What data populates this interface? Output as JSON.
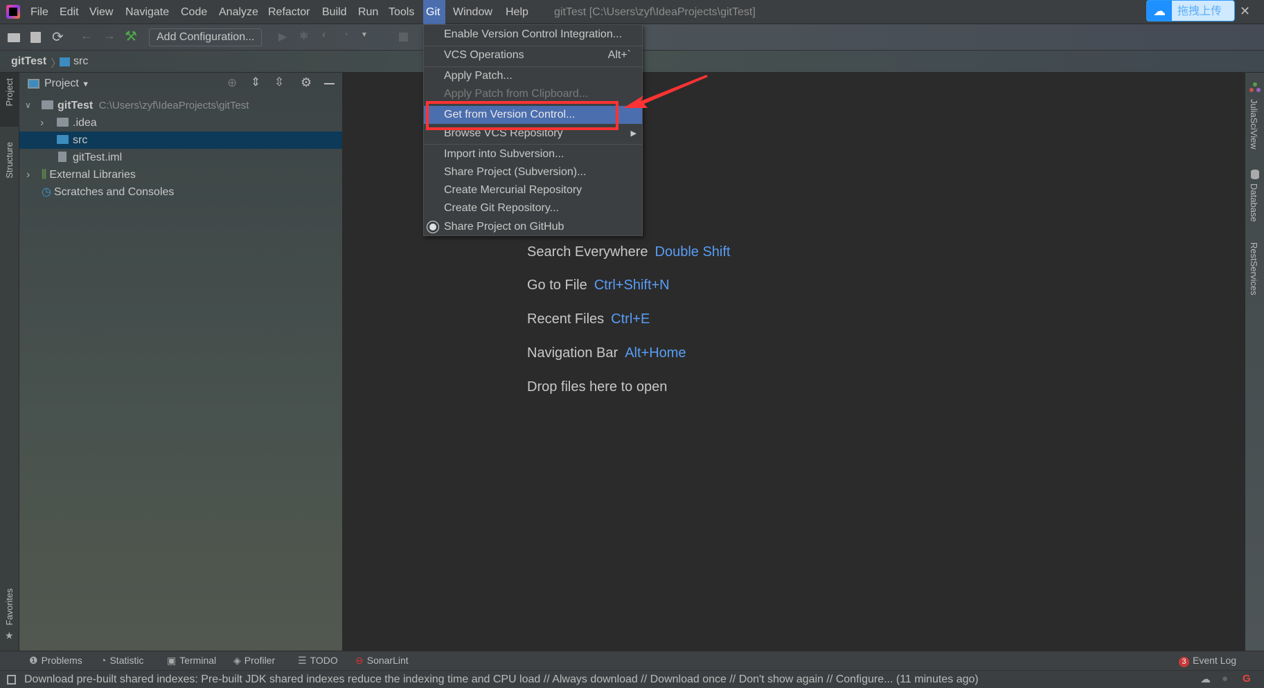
{
  "menubar": {
    "items": [
      "File",
      "Edit",
      "View",
      "Navigate",
      "Code",
      "Analyze",
      "Refactor",
      "Build",
      "Run",
      "Tools",
      "Git",
      "Window",
      "Help"
    ],
    "active": "Git",
    "title": "gitTest [C:\\Users\\zyf\\IdeaProjects\\gitTest]"
  },
  "overlay": {
    "upload_label": "拖拽上传",
    "close": "✕"
  },
  "toolbar": {
    "add_configuration": "Add Configuration..."
  },
  "breadcrumb": {
    "project": "gitTest",
    "folder": "src"
  },
  "left_stripe": {
    "project": "Project",
    "structure": "Structure",
    "favorites": "Favorites"
  },
  "right_stripe": {
    "julia": "JuliaSciView",
    "database": "Database",
    "rest": "RestServices"
  },
  "project_panel": {
    "title": "Project",
    "root": {
      "name": "gitTest",
      "path": "C:\\Users\\zyf\\IdeaProjects\\gitTest"
    },
    "items": [
      ".idea",
      "src",
      "gitTest.iml",
      "External Libraries",
      "Scratches and Consoles"
    ],
    "selected": "src"
  },
  "git_menu": {
    "items": [
      {
        "label": "Enable Version Control Integration..."
      },
      {
        "label": "VCS Operations",
        "shortcut": "Alt+`"
      },
      {
        "label": "Apply Patch..."
      },
      {
        "label": "Apply Patch from Clipboard...",
        "disabled": true
      },
      {
        "label": "Get from Version Control...",
        "highlighted": true
      },
      {
        "label": "Browse VCS Repository",
        "submenu": true
      },
      {
        "label": "Import into Subversion..."
      },
      {
        "label": "Share Project (Subversion)..."
      },
      {
        "label": "Create Mercurial Repository"
      },
      {
        "label": "Create Git Repository..."
      },
      {
        "label": "Share Project on GitHub",
        "icon": "github-icon"
      }
    ]
  },
  "editor_hints": [
    {
      "label": "Search Everywhere",
      "key": "Double Shift"
    },
    {
      "label": "Go to File",
      "key": "Ctrl+Shift+N"
    },
    {
      "label": "Recent Files",
      "key": "Ctrl+E"
    },
    {
      "label": "Navigation Bar",
      "key": "Alt+Home"
    },
    {
      "label": "Drop files here to open",
      "key": ""
    }
  ],
  "bottom_tools": [
    "Problems",
    "Statistic",
    "Terminal",
    "Profiler",
    "TODO",
    "SonarLint"
  ],
  "event_log": {
    "label": "Event Log",
    "count": "3"
  },
  "status": "Download pre-built shared indexes: Pre-built JDK shared indexes reduce the indexing time and CPU load // Always download // Download once // Don't show again // Configure... (11 minutes ago)",
  "colors": {
    "accent": "#4b6eaf",
    "annotation": "#ff3333",
    "link": "#589df6"
  }
}
